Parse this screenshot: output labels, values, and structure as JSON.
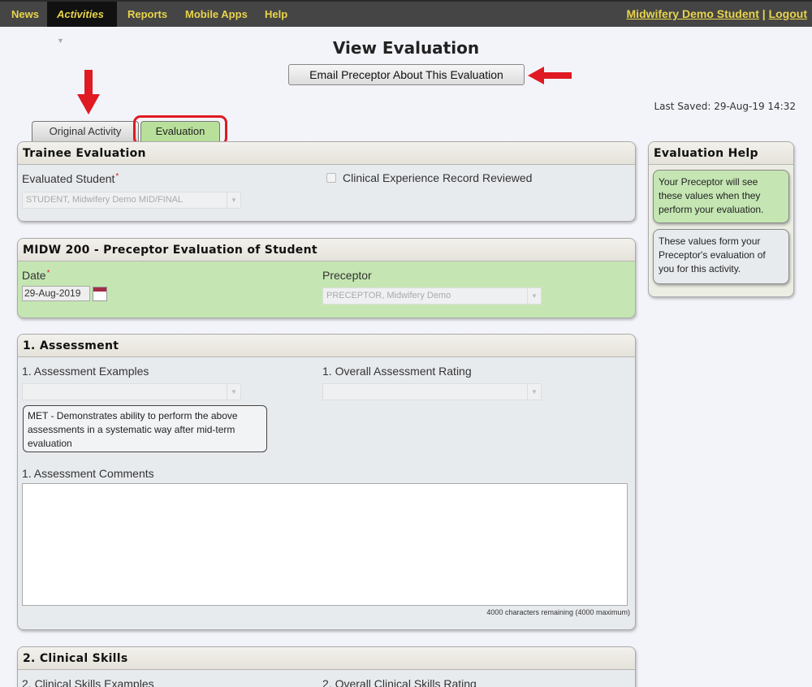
{
  "nav": {
    "items": [
      "News",
      "Activities",
      "Reports",
      "Mobile Apps",
      "Help"
    ],
    "activities_caret": "▼",
    "user": "Midwifery Demo Student",
    "separator": "|",
    "logout": "Logout"
  },
  "title": "View Evaluation",
  "email_button": "Email Preceptor About This Evaluation",
  "last_saved": "Last Saved: 29-Aug-19 14:32",
  "tabs": [
    "Original Activity",
    "Evaluation"
  ],
  "trainee": {
    "heading": "Trainee Evaluation",
    "student_label": "Evaluated Student",
    "student_value": "STUDENT, Midwifery Demo MID/FINAL",
    "checkbox_label": "Clinical Experience Record Reviewed"
  },
  "course": {
    "heading": "MIDW 200 - Preceptor Evaluation of Student",
    "date_label": "Date",
    "date_value": "29-Aug-2019",
    "preceptor_label": "Preceptor",
    "preceptor_value": "PRECEPTOR, Midwifery Demo"
  },
  "assessment": {
    "heading": "1. Assessment",
    "examples_label": "1. Assessment Examples",
    "rating_label": "1. Overall Assessment Rating",
    "note": "MET - Demonstrates ability to perform the above assessments in a systematic way after mid-term evaluation",
    "comments_label": "1. Assessment Comments",
    "remaining": "4000 characters remaining (4000 maximum)"
  },
  "clinical": {
    "heading": "2. Clinical Skills",
    "examples_label": "2. Clinical Skills Examples",
    "rating_label": "2. Overall Clinical Skills Rating"
  },
  "help": {
    "heading": "Evaluation Help",
    "bubble1": "Your Preceptor will see these values when they perform your evaluation.",
    "bubble2": "These values form your Preceptor's evaluation of you for this activity.",
    "bubble1_color": "#c5e6b3",
    "bubble2_color": "#e8ebee"
  },
  "colors": {
    "nav_bg": "#454545",
    "nav_text": "#e9d44b",
    "accent_green": "#b9e09a",
    "annotation_red": "#e01a22"
  }
}
